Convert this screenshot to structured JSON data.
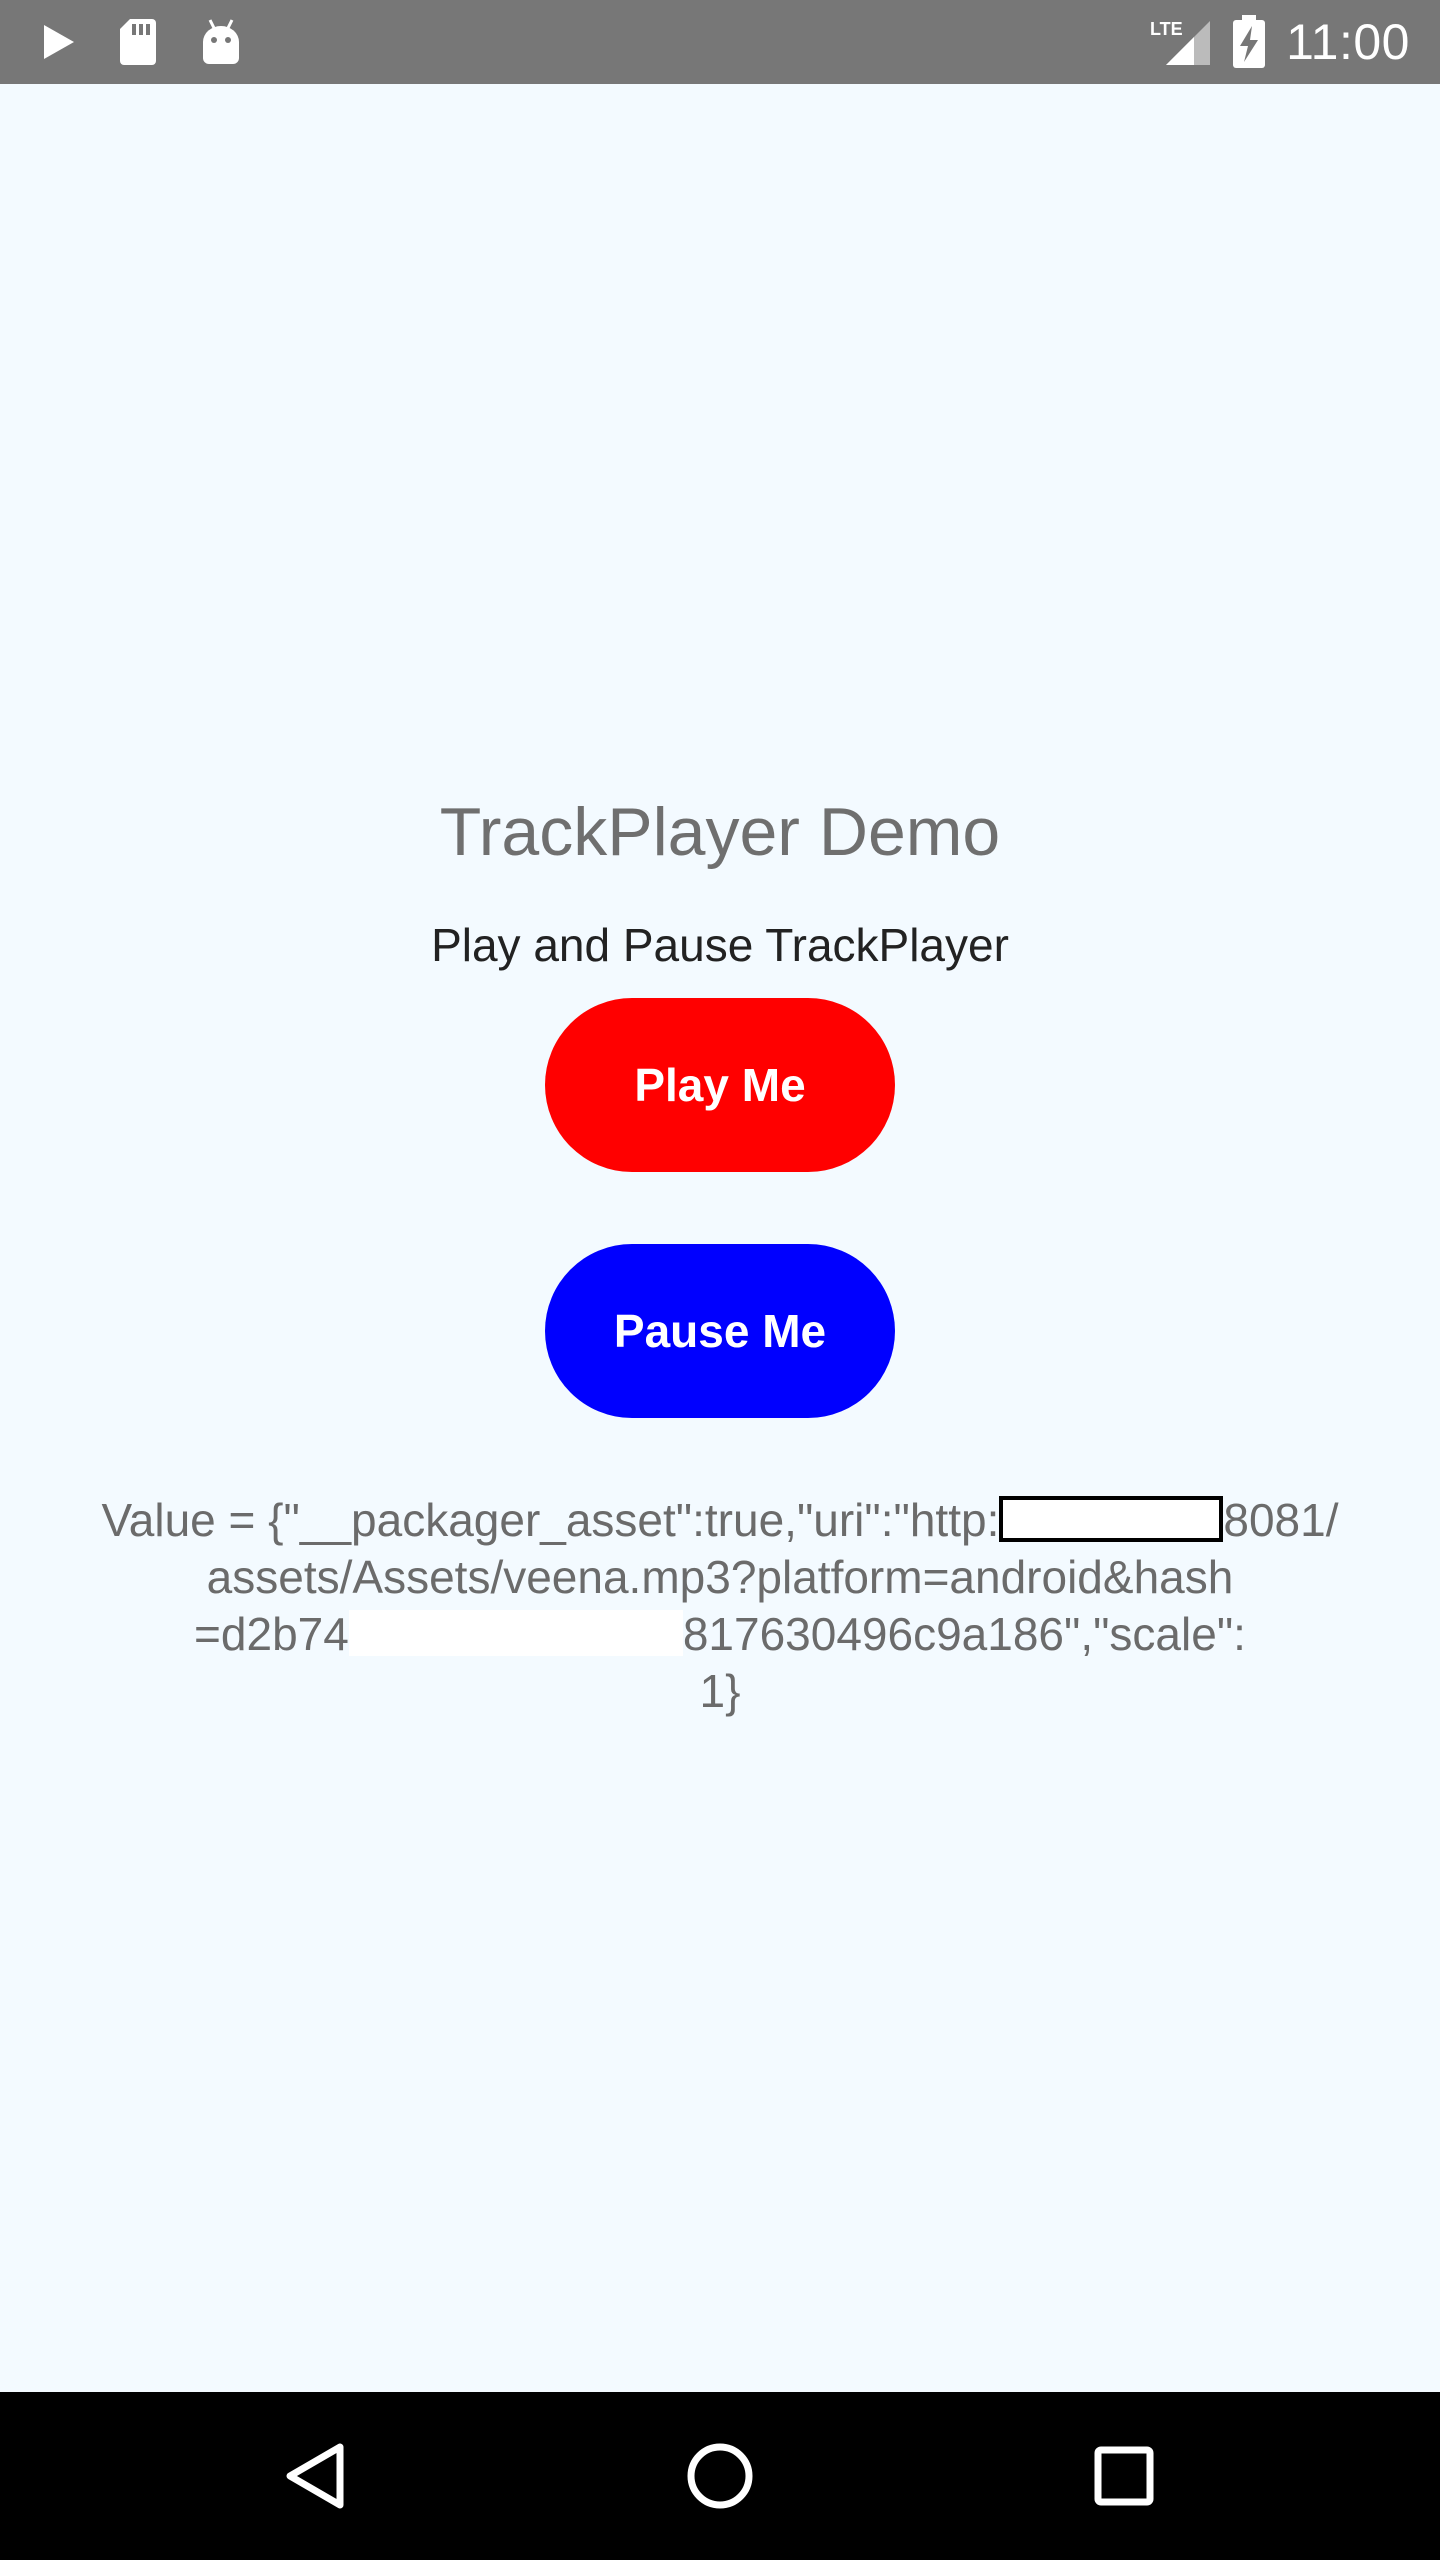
{
  "status_bar": {
    "left_icons": [
      "play-icon",
      "sd-card-icon",
      "android-icon"
    ],
    "network_label": "LTE",
    "clock": "11:00"
  },
  "main": {
    "title": "TrackPlayer Demo",
    "subtitle": "Play and Pause TrackPlayer",
    "play_button": {
      "label": "Play Me",
      "color": "#ff0000"
    },
    "pause_button": {
      "label": "Pause Me",
      "color": "#0000ff"
    },
    "value_text": {
      "line1_prefix": "Value = {\"__packager_asset\":true,\"uri\":\"http:",
      "line1_suffix": "8081/",
      "line2": "assets/Assets/veena.mp3?platform=android&hash",
      "line3_prefix": "=d2b74",
      "line3_suffix": "817630496c9a186\",\"scale\":",
      "line4": "1}"
    }
  },
  "nav_bar": {
    "buttons": [
      "back-icon",
      "home-icon",
      "recent-apps-icon"
    ]
  },
  "colors": {
    "status_bar": "#777777",
    "background": "#f3faff",
    "title_text": "#6f6f6f",
    "nav_bar": "#000000"
  }
}
